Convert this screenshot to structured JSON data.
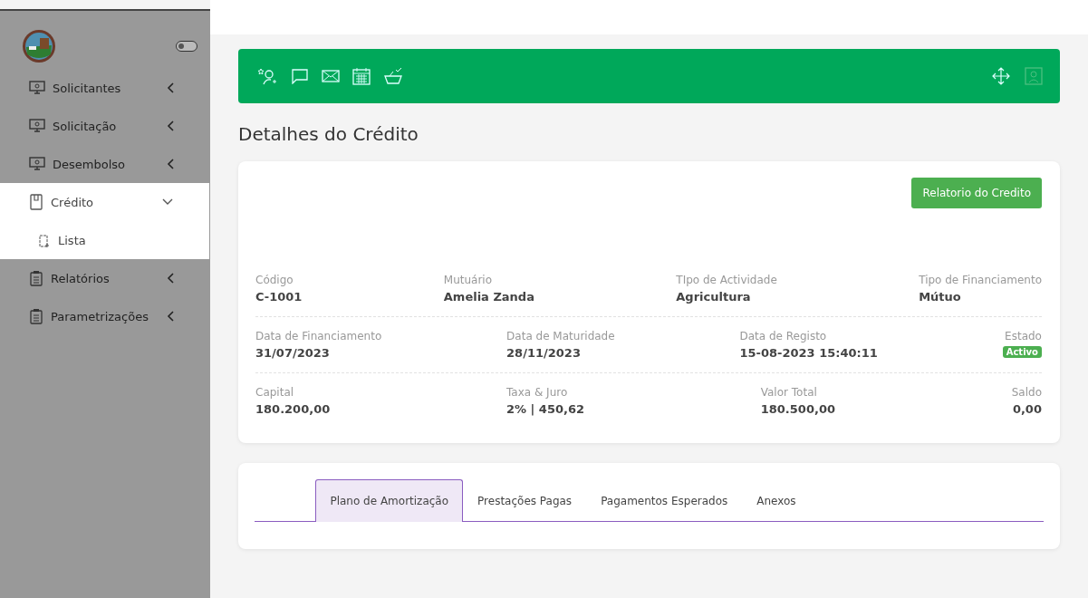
{
  "sidebar": {
    "toggle_on": false,
    "items": [
      {
        "label": "Solicitantes",
        "kind": "monitor",
        "expanded": false
      },
      {
        "label": "Solicitação",
        "kind": "monitor",
        "expanded": false
      },
      {
        "label": "Desembolso",
        "kind": "monitor",
        "expanded": false
      },
      {
        "label": "Crédito",
        "kind": "book",
        "expanded": true,
        "children": [
          {
            "label": "Lista"
          }
        ]
      },
      {
        "label": "Relatórios",
        "kind": "clipboard",
        "expanded": false
      },
      {
        "label": "Parametrizações",
        "kind": "clipboard",
        "expanded": false
      }
    ]
  },
  "page_title": "Detalhes do Crédito",
  "report_button": "Relatorio do Credito",
  "detail_rows": [
    [
      {
        "label": "Código",
        "value": "C-1001",
        "kind": "text"
      },
      {
        "label": "Mutuário",
        "value": "Amelia Zanda",
        "kind": "text"
      },
      {
        "label": "TIpo de Actividade",
        "value": "Agricultura",
        "kind": "text"
      },
      {
        "label": "Tipo de Financiamento",
        "value": "Mútuo",
        "kind": "text"
      }
    ],
    [
      {
        "label": "Data de Financiamento",
        "value": "31/07/2023",
        "kind": "text"
      },
      {
        "label": "Data de Maturidade",
        "value": "28/11/2023",
        "kind": "text"
      },
      {
        "label": "Data de Registo",
        "value": "15-08-2023 15:40:11",
        "kind": "text"
      },
      {
        "label": "Estado",
        "value": "Activo",
        "kind": "badge"
      }
    ],
    [
      {
        "label": "Capital",
        "value": "180.200,00",
        "kind": "text"
      },
      {
        "label": "Taxa & Juro",
        "value": "2% | 450,62",
        "kind": "text"
      },
      {
        "label": "Valor Total",
        "value": "180.500,00",
        "kind": "text"
      },
      {
        "label": "Saldo",
        "value": "0,00",
        "kind": "text"
      }
    ]
  ],
  "tabs": [
    {
      "label": "Plano de Amortização",
      "selected": true
    },
    {
      "label": "Prestações Pagas",
      "selected": false
    },
    {
      "label": "Pagamentos Esperados",
      "selected": false
    },
    {
      "label": "Anexos",
      "selected": false
    }
  ]
}
